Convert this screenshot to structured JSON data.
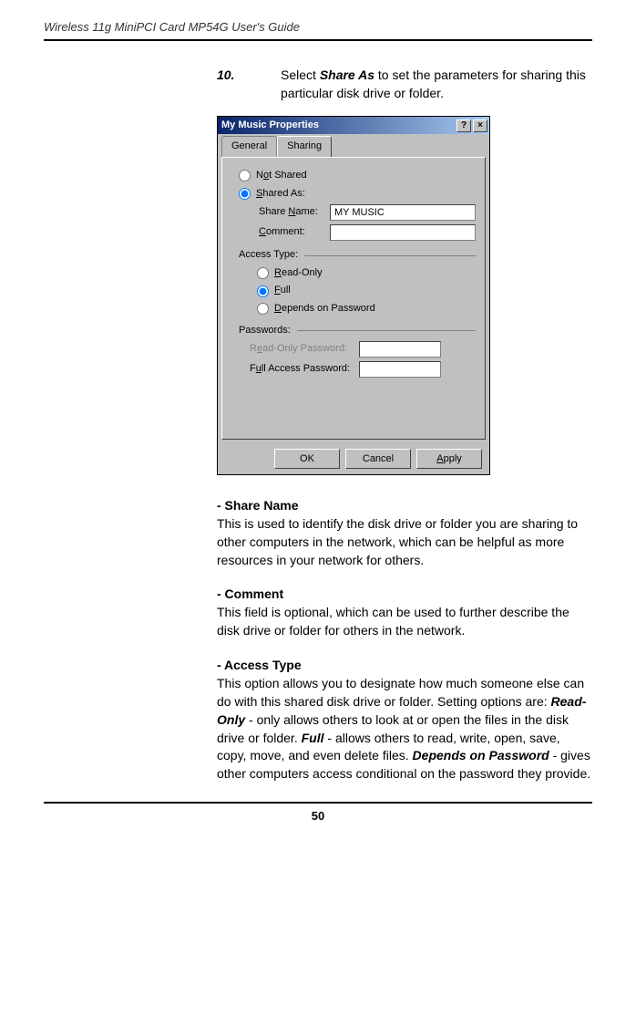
{
  "header": "Wireless 11g MiniPCI Card MP54G User's Guide",
  "step": {
    "num": "10.",
    "prefix": "Select ",
    "cmd": "Share As",
    "suffix": " to set the parameters for sharing this particular disk drive or folder."
  },
  "dialog": {
    "title": "My Music Properties",
    "help": "?",
    "close": "×",
    "tabs": {
      "general": "General",
      "sharing": "Sharing"
    },
    "not_shared": "Not Shared",
    "shared_as": "Shared As:",
    "share_name_label": "Share Name:",
    "share_name_value": "MY MUSIC",
    "comment_label": "Comment:",
    "comment_value": "",
    "access_type": "Access Type:",
    "read_only": "Read-Only",
    "full": "Full",
    "depends": "Depends on Password",
    "passwords": "Passwords:",
    "ro_pw": "Read-Only Password:",
    "full_pw": "Full Access Password:",
    "ok": "OK",
    "cancel": "Cancel",
    "apply": "Apply"
  },
  "sections": {
    "share_name": {
      "title": "- Share Name",
      "body": "This is used to identify the disk drive or folder you are sharing to other computers in the network, which can be helpful as more resources in your network for others."
    },
    "comment": {
      "title": "- Comment",
      "body": "This field is optional, which can be used to further describe the disk drive or folder for others in the network."
    },
    "access_type": {
      "title": "- Access Type",
      "body_pre": "This option allows you to designate how much someone else can do with this shared disk drive or folder.  Setting options are: ",
      "read_only": "Read-Only",
      "body_mid1": " - only allows others to look at or open the files in the disk drive or folder.  ",
      "full": "Full",
      "body_mid2": " - allows others to read, write, open, save, copy, move, and even delete files.  ",
      "depends": "Depends on Password",
      "body_end": " - gives other computers access conditional on the password they provide."
    }
  },
  "pageNumber": "50"
}
